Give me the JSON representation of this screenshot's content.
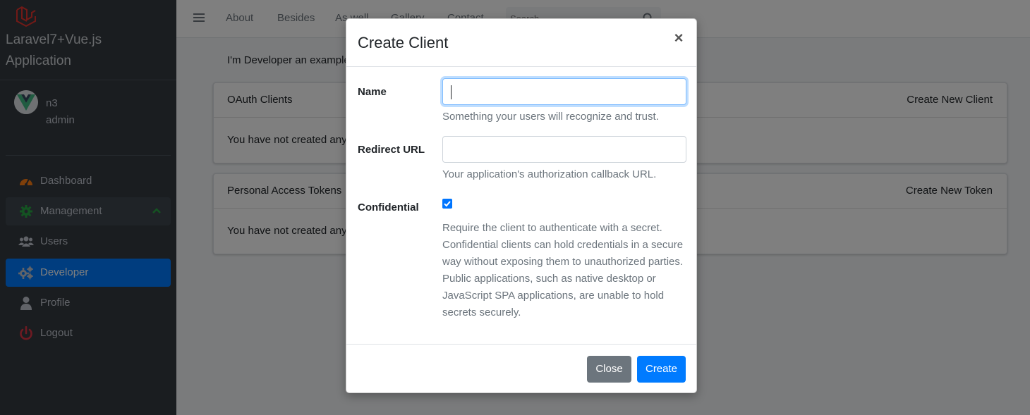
{
  "sidebar": {
    "brand_line1": "Laravel7+Vue.js",
    "brand_line2": "Application",
    "user": {
      "name": "n3",
      "role": "admin"
    },
    "items": [
      {
        "label": "Dashboard",
        "icon": "tachometer-icon"
      },
      {
        "label": "Management",
        "icon": "cog-icon"
      },
      {
        "label": "Users",
        "icon": "users-icon"
      },
      {
        "label": "Developer",
        "icon": "cogs-icon"
      },
      {
        "label": "Profile",
        "icon": "user-icon"
      },
      {
        "label": "Logout",
        "icon": "power-icon"
      }
    ]
  },
  "navbar": {
    "links": [
      "About",
      "Besides",
      "As well",
      "Gallery",
      "Contact"
    ],
    "search_placeholder": "Search"
  },
  "content": {
    "intro": "I'm Developer an example component.",
    "oauth": {
      "title": "OAuth Clients",
      "action": "Create New Client",
      "empty": "You have not created any OAuth clients."
    },
    "tokens": {
      "title": "Personal Access Tokens",
      "action": "Create New Token",
      "empty": "You have not created any personal access tokens."
    }
  },
  "modal": {
    "title": "Create Client",
    "close_symbol": "×",
    "name_label": "Name",
    "name_value": "",
    "name_help": "Something your users will recognize and trust.",
    "redirect_label": "Redirect URL",
    "redirect_value": "",
    "redirect_help": "Your application's authorization callback URL.",
    "confidential_label": "Confidential",
    "confidential_checked": true,
    "confidential_help": "Require the client to authenticate with a secret. Confidential clients can hold credentials in a secure way without exposing them to unauthorized parties. Public applications, such as native desktop or JavaScript SPA applications, are unable to hold secrets securely.",
    "close_button": "Close",
    "create_button": "Create"
  },
  "colors": {
    "sidebar_bg": "#343a40",
    "active_item": "#007bff",
    "primary": "#007bff",
    "secondary": "#6c757d",
    "brand_red": "#e3342f"
  }
}
